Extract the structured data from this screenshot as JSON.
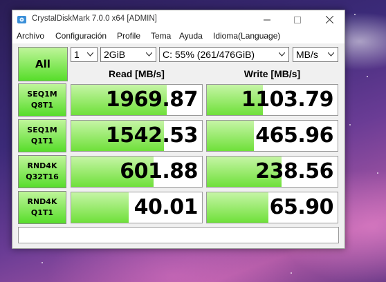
{
  "window": {
    "title": "CrystalDiskMark 7.0.0 x64 [ADMIN]"
  },
  "menu": [
    "Archivo",
    "Configuración",
    "Profile",
    "Tema",
    "Ayuda",
    "Idioma(Language)"
  ],
  "controls": {
    "all_label": "All",
    "count": "1",
    "size": "2GiB",
    "drive": "C: 55% (261/476GiB)",
    "unit": "MB/s"
  },
  "headers": {
    "read": "Read [MB/s]",
    "write": "Write [MB/s]"
  },
  "rows": [
    {
      "name1": "SEQ1M",
      "name2": "Q8T1",
      "read": "1969.87",
      "write": "1103.79",
      "read_fill": 0.73,
      "write_fill": 0.43
    },
    {
      "name1": "SEQ1M",
      "name2": "Q1T1",
      "read": "1542.53",
      "write": "465.96",
      "read_fill": 0.71,
      "write_fill": 0.36
    },
    {
      "name1": "RND4K",
      "name2": "Q32T16",
      "read": "601.88",
      "write": "238.56",
      "read_fill": 0.63,
      "write_fill": 0.57
    },
    {
      "name1": "RND4K",
      "name2": "Q1T1",
      "read": "40.01",
      "write": "65.90",
      "read_fill": 0.44,
      "write_fill": 0.47
    }
  ],
  "colors": {
    "accent_green": "#57dd2a",
    "bar_green": "#6fe03a"
  }
}
